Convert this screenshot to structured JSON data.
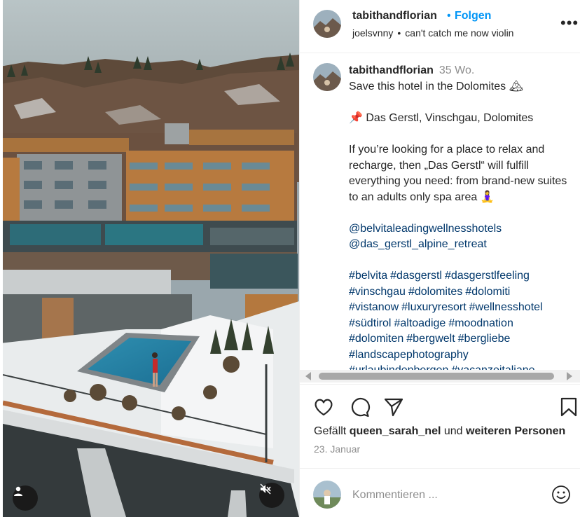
{
  "header": {
    "username": "tabithandflorian",
    "follow_separator": "•",
    "follow_label": "Folgen",
    "audio_user": "joelsvnny",
    "audio_separator": "•",
    "audio_track": "can't catch me now violin",
    "more_glyph": "•••"
  },
  "caption": {
    "username": "tabithandflorian",
    "time_ago": "35 Wo.",
    "line1": "Save this hotel in the Dolomites 🏔",
    "line2": "📌 Das Gerstl, Vinschgau, Dolomites",
    "line3": "If you’re looking for a place to relax and recharge, then „Das Gerstl“ will fulfill everything you need: from brand-new suites to an adults only spa area 🧘‍♀️",
    "mentions": [
      "@belvitaleadingwellnesshotels",
      "@das_gerstl_alpine_retreat"
    ],
    "hashtags": [
      "#belvita",
      "#dasgerstl",
      "#dasgerstlfeeling",
      "#vinschgau",
      "#dolomites",
      "#dolomiti",
      "#vistanow",
      "#luxuryresort",
      "#wellnesshotel",
      "#südtirol",
      "#altoadige",
      "#moodnation",
      "#dolomiten",
      "#bergwelt",
      "#bergliebe",
      "#landscapephotography",
      "#urlaubindenbergen",
      "#vacanzeitaliane"
    ]
  },
  "actions": {
    "like_icon": "heart-icon",
    "comment_icon": "comment-bubble-icon",
    "share_icon": "paper-plane-icon",
    "save_icon": "bookmark-icon"
  },
  "likes": {
    "prefix": "Gefällt ",
    "user": "queen_sarah_nel",
    "middle": " und ",
    "rest": "weiteren Personen"
  },
  "date": "23. Januar",
  "comment": {
    "placeholder": "Kommentieren ...",
    "emoji_icon": "smiley-icon"
  },
  "media": {
    "user_tag_icon": "person-icon",
    "mute_icon": "speaker-muted-icon"
  },
  "colors": {
    "accent": "#0095f6",
    "link": "#00376b",
    "muted": "#8e8e8e",
    "text": "#262626"
  }
}
